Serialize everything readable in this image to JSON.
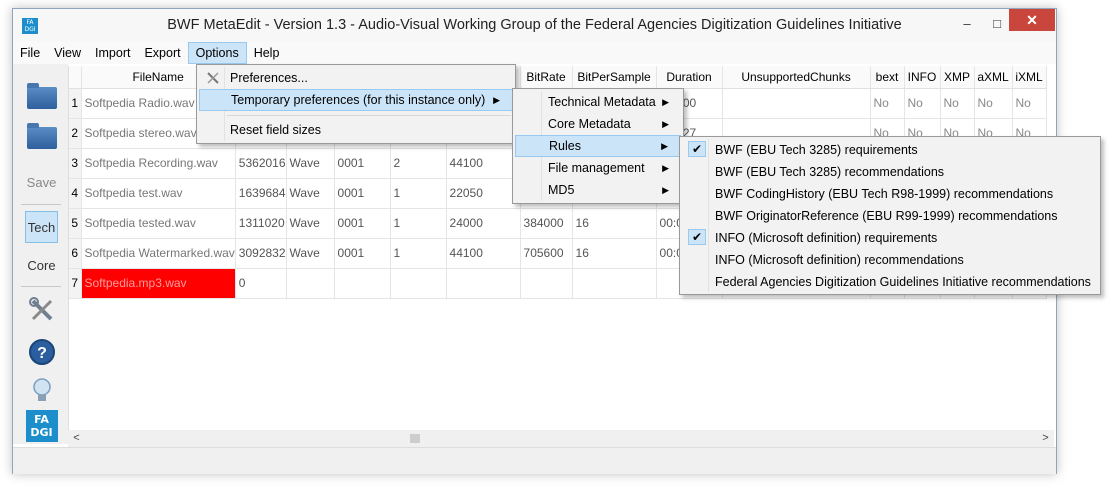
{
  "window": {
    "icon_text": "FA DGI",
    "title": "BWF MetaEdit - Version 1.3 - Audio-Visual Working Group of the Federal Agencies Digitization Guidelines Initiative",
    "controls": {
      "minimize": "–",
      "maximize": "□",
      "close": "✕"
    }
  },
  "menubar": [
    "File",
    "View",
    "Import",
    "Export",
    "Options",
    "Help"
  ],
  "toolbar": {
    "save": "Save",
    "tech": "Tech",
    "core": "Core",
    "help": "?",
    "fadgi_logo": "FA DGI"
  },
  "grid": {
    "columns": [
      "",
      "FileName",
      "",
      "",
      "",
      "",
      "",
      "BitRate",
      "BitPerSample",
      "Duration",
      "UnsupportedChunks",
      "bext",
      "INFO",
      "XMP",
      "aXML",
      "iXML"
    ],
    "rows": [
      {
        "num": "1",
        "file": "Softpedia Radio.wav",
        "size": "",
        "format": "",
        "tag": "",
        "ch": "",
        "rate": "",
        "bitrate": "",
        "bps": "",
        "dur": "00.000",
        "bext": "No",
        "info": "No",
        "xmp": "No",
        "axml": "No",
        "ixml": "No"
      },
      {
        "num": "2",
        "file": "Softpedia stereo.wav",
        "size": "",
        "format": "",
        "tag": "",
        "ch": "",
        "rate": "",
        "bitrate": "",
        "bps": "",
        "dur": "00.527",
        "bext": "No",
        "info": "No",
        "xmp": "No",
        "axml": "No",
        "ixml": "No"
      },
      {
        "num": "3",
        "file": "Softpedia Recording.wav",
        "size": "5362016",
        "format": "Wave",
        "tag": "0001",
        "ch": "2",
        "rate": "44100",
        "bitrate": "",
        "bps": "",
        "dur": "",
        "bext": "",
        "info": "",
        "xmp": "",
        "axml": "",
        "ixml": ""
      },
      {
        "num": "4",
        "file": "Softpedia test.wav",
        "size": "1639684",
        "format": "Wave",
        "tag": "0001",
        "ch": "1",
        "rate": "22050",
        "bitrate": "",
        "bps": "",
        "dur": "",
        "bext": "",
        "info": "",
        "xmp": "",
        "axml": "",
        "ixml": ""
      },
      {
        "num": "5",
        "file": "Softpedia tested.wav",
        "size": "1311020",
        "format": "Wave",
        "tag": "0001",
        "ch": "1",
        "rate": "24000",
        "bitrate": "384000",
        "bps": "16",
        "dur": "00:0",
        "bext": "",
        "info": "",
        "xmp": "",
        "axml": "",
        "ixml": ""
      },
      {
        "num": "6",
        "file": "Softpedia Watermarked.wav",
        "size": "3092832",
        "format": "Wave",
        "tag": "0001",
        "ch": "1",
        "rate": "44100",
        "bitrate": "705600",
        "bps": "16",
        "dur": "00:0",
        "bext": "",
        "info": "",
        "xmp": "",
        "axml": "",
        "ixml": ""
      },
      {
        "num": "7",
        "file": "Softpedia.mp3.wav",
        "size": "0",
        "format": "",
        "tag": "",
        "ch": "",
        "rate": "",
        "bitrate": "",
        "bps": "",
        "dur": "",
        "bext": "",
        "info": "",
        "xmp": "",
        "axml": "",
        "ixml": ""
      }
    ]
  },
  "options_menu": {
    "items": [
      "Preferences...",
      "Temporary preferences (for this instance only)",
      "Reset field sizes"
    ]
  },
  "temp_menu": {
    "items": [
      "Technical Metadata",
      "Core Metadata",
      "Rules",
      "File management",
      "MD5"
    ]
  },
  "rules_menu": {
    "items": [
      {
        "label": "BWF (EBU Tech 3285) requirements",
        "checked": true
      },
      {
        "label": "BWF (EBU Tech 3285) recommendations",
        "checked": false
      },
      {
        "label": "BWF CodingHistory (EBU Tech R98-1999) recommendations",
        "checked": false
      },
      {
        "label": "BWF OriginatorReference (EBU R99-1999) recommendations",
        "checked": false
      },
      {
        "label": "INFO (Microsoft definition) requirements",
        "checked": true
      },
      {
        "label": "INFO (Microsoft definition) recommendations",
        "checked": false
      },
      {
        "label": "Federal Agencies Digitization Guidelines Initiative recommendations",
        "checked": false
      }
    ],
    "check_glyph": "✔"
  },
  "scrollbar": {
    "left": "<",
    "right": ">"
  },
  "colors": {
    "error_cell": "#ff0000",
    "highlight": "#cce4f7",
    "close_button": "#c9463d"
  }
}
